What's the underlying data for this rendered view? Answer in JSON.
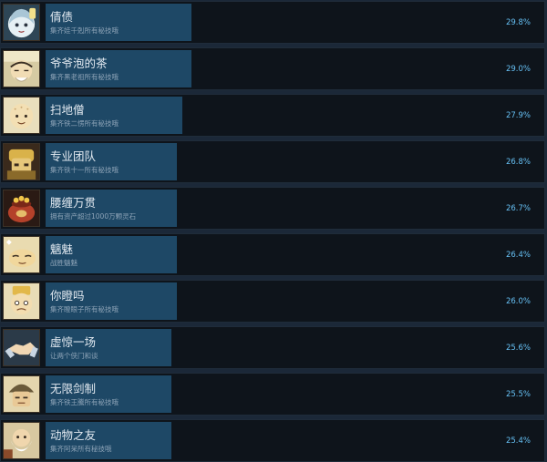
{
  "achievements": [
    {
      "title": "倩债",
      "description": "集齐娃千剋所有秘技哦",
      "percent_text": "29.8%",
      "percent": 29.8,
      "icon": "ghost-girl-icon"
    },
    {
      "title": "爷爷泡的茶",
      "description": "集齐黑老祖所有秘技哦",
      "percent_text": "29.0%",
      "percent": 29.0,
      "icon": "old-man-icon"
    },
    {
      "title": "扫地僧",
      "description": "集齐铁二愣所有秘技哦",
      "percent_text": "27.9%",
      "percent": 27.9,
      "icon": "bald-monk-icon"
    },
    {
      "title": "专业团队",
      "description": "集齐铁十一所有秘技哦",
      "percent_text": "26.8%",
      "percent": 26.8,
      "icon": "golden-warrior-icon"
    },
    {
      "title": "腰缠万贯",
      "description": "拥有资产超过1000万颗灵石",
      "percent_text": "26.7%",
      "percent": 26.7,
      "icon": "treasure-pot-icon"
    },
    {
      "title": "魑魅",
      "description": "战胜魑魅",
      "percent_text": "26.4%",
      "percent": 26.4,
      "icon": "sleeping-creature-icon"
    },
    {
      "title": "你瞪吗",
      "description": "集齐瞪眼子所有秘技哦",
      "percent_text": "26.0%",
      "percent": 26.0,
      "icon": "crowned-face-icon"
    },
    {
      "title": "虚惊一场",
      "description": "让两个侠门和谈",
      "percent_text": "25.6%",
      "percent": 25.6,
      "icon": "handshake-icon"
    },
    {
      "title": "无限剑制",
      "description": "集齐铁王騰所有秘技哦",
      "percent_text": "25.5%",
      "percent": 25.5,
      "icon": "helmet-warrior-icon"
    },
    {
      "title": "动物之友",
      "description": "集齐阿呆所有秘技哦",
      "percent_text": "25.4%",
      "percent": 25.4,
      "icon": "bearded-elder-icon"
    }
  ]
}
